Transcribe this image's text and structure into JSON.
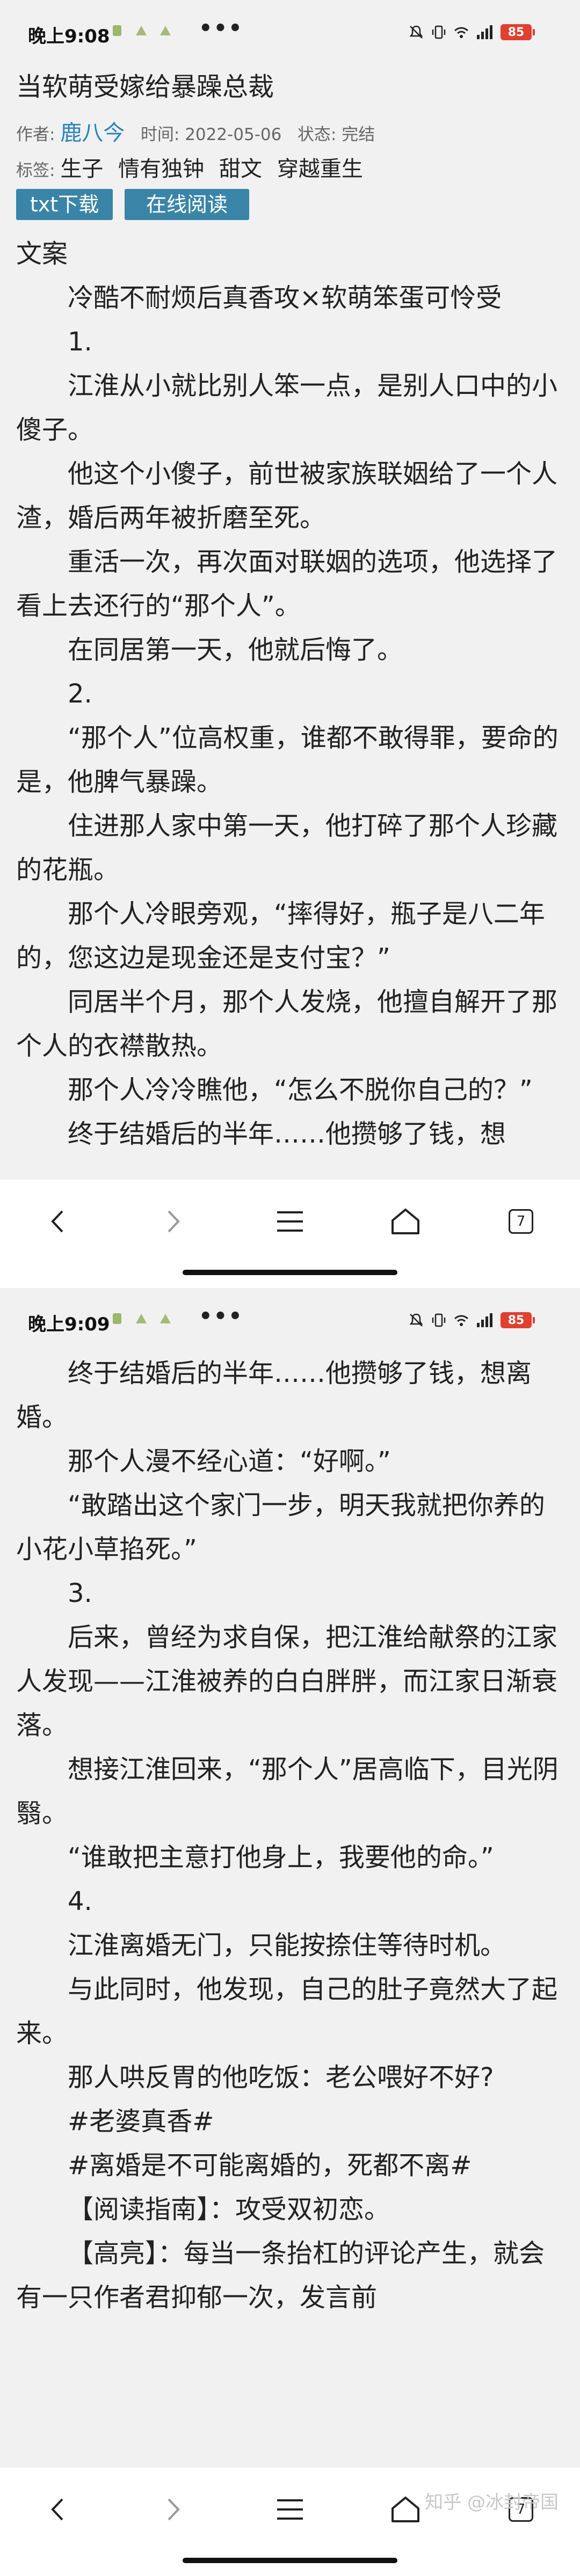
{
  "screen1": {
    "status": {
      "time": "晚上9:08",
      "dots": "•••",
      "battery": "85"
    },
    "book": {
      "title": "当软萌受嫁给暴躁总裁",
      "author_label": "作者:",
      "author": "鹿八今",
      "time_label": "时间:",
      "time": "2022-05-06",
      "status_label": "状态:",
      "status": "完结",
      "tags_label": "标签:",
      "tags": [
        "生子",
        "情有独钟",
        "甜文",
        "穿越重生"
      ],
      "btn_txt": "txt下载",
      "btn_read": "在线阅读"
    },
    "paragraphs": [
      "文案",
      "冷酷不耐烦后真香攻×软萌笨蛋可怜受",
      "1.",
      "江淮从小就比别人笨一点，是别人口中的小傻子。",
      "他这个小傻子，前世被家族联姻给了一个人渣，婚后两年被折磨至死。",
      "重活一次，再次面对联姻的选项，他选择了看上去还行的“那个人”。",
      "在同居第一天，他就后悔了。",
      "2.",
      "“那个人”位高权重，谁都不敢得罪，要命的是，他脾气暴躁。",
      "住进那人家中第一天，他打碎了那个人珍藏的花瓶。",
      "那个人冷眼旁观，“摔得好，瓶子是八二年的，您这边是现金还是支付宝？”",
      "同居半个月，那个人发烧，他擅自解开了那个人的衣襟散热。",
      "那个人冷冷瞧他，“怎么不脱你自己的？”",
      "终于结婚后的半年……他攒够了钱，想"
    ],
    "nav": {
      "tabs_count": "7"
    }
  },
  "screen2": {
    "status": {
      "time": "晚上9:09",
      "dots": "•••",
      "battery": "85"
    },
    "paragraphs": [
      "终于结婚后的半年……他攒够了钱，想离婚。",
      "那个人漫不经心道：“好啊。”",
      "“敢踏出这个家门一步，明天我就把你养的小花小草掐死。”",
      "3.",
      "后来，曾经为求自保，把江淮给献祭的江家人发现——江淮被养的白白胖胖，而江家日渐衰落。",
      "想接江淮回来，“那个人”居高临下，目光阴翳。",
      "“谁敢把主意打他身上，我要他的命。”",
      "4.",
      "江淮离婚无门，只能按捺住等待时机。",
      "与此同时，他发现，自己的肚子竟然大了起来。",
      "那人哄反胃的他吃饭：老公喂好不好?",
      "#老婆真香#",
      "#离婚是不可能离婚的，死都不离#",
      "【阅读指南】：攻受双初恋。",
      "【高亮】：每当一条抬杠的评论产生，就会有一只作者君抑郁一次，发言前"
    ],
    "watermark": "知乎 @冰封帝国",
    "nav": {
      "tabs_count": "7"
    }
  }
}
